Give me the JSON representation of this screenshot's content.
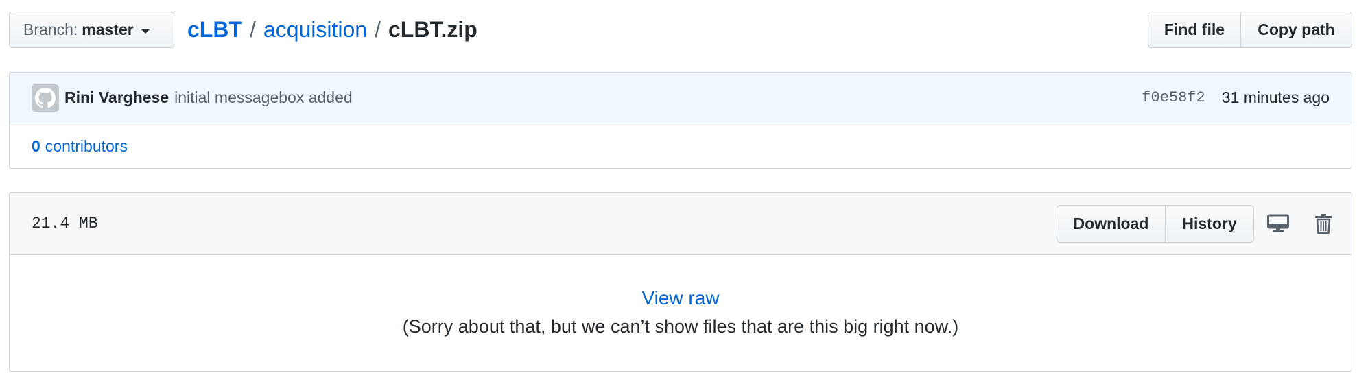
{
  "branch": {
    "prefix": "Branch:",
    "name": "master"
  },
  "breadcrumb": {
    "repo": "cLBT",
    "separator": "/",
    "dir": "acquisition",
    "file": "cLBT.zip"
  },
  "top_actions": {
    "find_file": "Find file",
    "copy_path": "Copy path"
  },
  "commit": {
    "author": "Rini Varghese",
    "message": "initial messagebox added",
    "sha": "f0e58f2",
    "time": "31 minutes ago"
  },
  "contributors": {
    "count": "0",
    "label": "contributors"
  },
  "file": {
    "size": "21.4 MB",
    "download": "Download",
    "history": "History",
    "desktop_icon": "desktop-icon",
    "trash_icon": "trash-icon",
    "view_raw": "View raw",
    "too_big_message": "(Sorry about that, but we can’t show files that are this big right now.)"
  },
  "colors": {
    "link": "#0366d6",
    "commit_bg": "#f1f8ff",
    "header_bg": "#f6f8fa"
  }
}
